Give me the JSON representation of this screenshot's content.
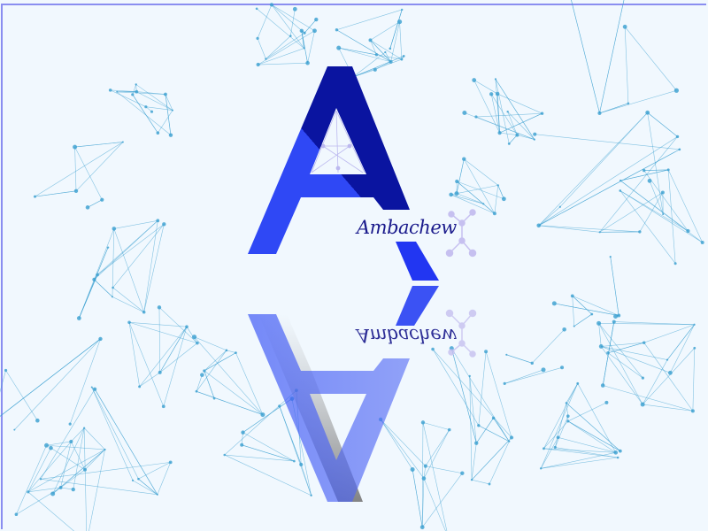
{
  "logo": {
    "letter": "A",
    "brand_name": "Ambachew",
    "colors": {
      "background": "#f1f8fe",
      "letter_dark": "#0a14a0",
      "letter_light": "#2f48f5",
      "brand_text": "#1a1a8c",
      "network": "#3a9fd0",
      "network_accent": "#b7b3ee",
      "frame": "#8a8ef0"
    },
    "background_pattern": "network-dots-lines",
    "reflection": true
  }
}
